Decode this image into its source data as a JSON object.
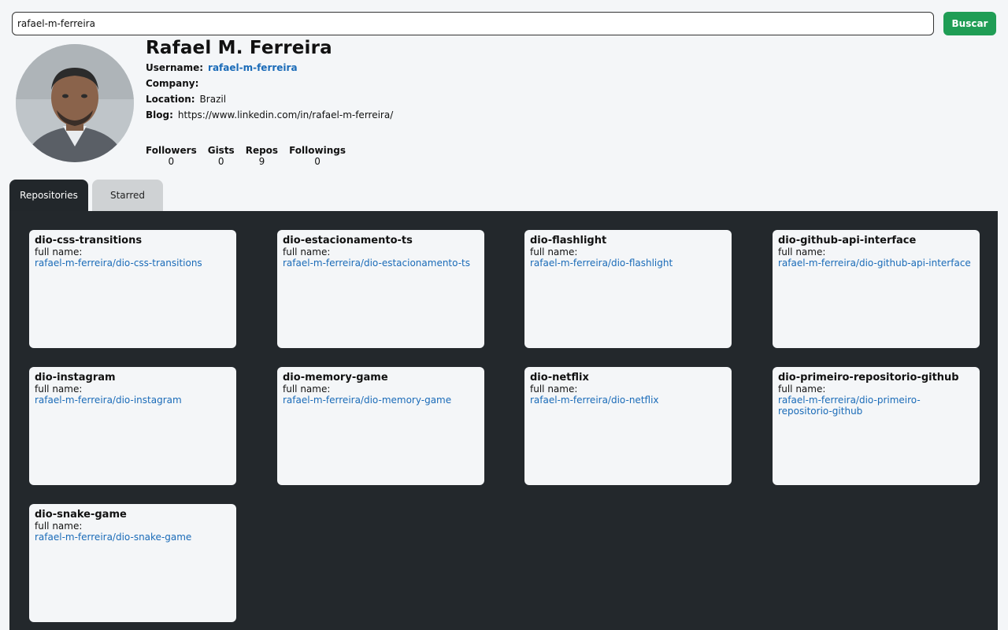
{
  "search": {
    "value": "rafael-m-ferreira",
    "button_label": "Buscar"
  },
  "profile": {
    "name": "Rafael M. Ferreira",
    "username_label": "Username:",
    "username": "rafael-m-ferreira",
    "company_label": "Company:",
    "company": "",
    "location_label": "Location:",
    "location": "Brazil",
    "blog_label": "Blog:",
    "blog": "https://www.linkedin.com/in/rafael-m-ferreira/"
  },
  "stats": [
    {
      "label": "Followers",
      "value": "0"
    },
    {
      "label": "Gists",
      "value": "0"
    },
    {
      "label": "Repos",
      "value": "9"
    },
    {
      "label": "Followings",
      "value": "0"
    }
  ],
  "tabs": [
    {
      "label": "Repositories",
      "active": true
    },
    {
      "label": "Starred",
      "active": false
    }
  ],
  "repos": [
    {
      "name": "dio-css-transitions",
      "full_name_label": "full name:",
      "full_name": "rafael-m-ferreira/dio-css-transitions"
    },
    {
      "name": "dio-estacionamento-ts",
      "full_name_label": "full name:",
      "full_name": "rafael-m-ferreira/dio-estacionamento-ts"
    },
    {
      "name": "dio-flashlight",
      "full_name_label": "full name:",
      "full_name": "rafael-m-ferreira/dio-flashlight"
    },
    {
      "name": "dio-github-api-interface",
      "full_name_label": "full name:",
      "full_name": "rafael-m-ferreira/dio-github-api-interface"
    },
    {
      "name": "dio-instagram",
      "full_name_label": "full name:",
      "full_name": "rafael-m-ferreira/dio-instagram"
    },
    {
      "name": "dio-memory-game",
      "full_name_label": "full name:",
      "full_name": "rafael-m-ferreira/dio-memory-game"
    },
    {
      "name": "dio-netflix",
      "full_name_label": "full name:",
      "full_name": "rafael-m-ferreira/dio-netflix"
    },
    {
      "name": "dio-primeiro-repositorio-github",
      "full_name_label": "full name:",
      "full_name": "rafael-m-ferreira/dio-primeiro-repositorio-github"
    },
    {
      "name": "dio-snake-game",
      "full_name_label": "full name:",
      "full_name": "rafael-m-ferreira/dio-snake-game"
    }
  ],
  "colors": {
    "accent_green": "#1f9d55",
    "link_blue": "#1a6bb8",
    "panel_dark": "#23282c"
  },
  "icons": {
    "avatar": "profile-photo"
  }
}
